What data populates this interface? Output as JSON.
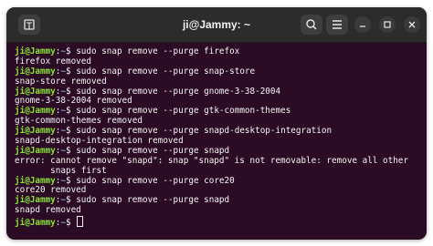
{
  "window": {
    "title": "ji@Jammy: ~"
  },
  "icons": {
    "new_tab": "new-tab-icon",
    "search": "search-icon",
    "menu": "hamburger-menu-icon",
    "minimize": "minimize-icon",
    "maximize": "maximize-icon",
    "close": "close-icon"
  },
  "colors": {
    "terminal_bg": "#2c0b24",
    "titlebar_bg": "#2c2c2c",
    "prompt_user": "#8ae234",
    "prompt_path": "#729fcf",
    "text": "#f4f4f4"
  },
  "prompt": {
    "user_host": "ji@Jammy",
    "path": "~",
    "symbol": "$"
  },
  "lines": [
    {
      "type": "command",
      "text": " sudo snap remove --purge firefox"
    },
    {
      "type": "output",
      "text": "firefox removed"
    },
    {
      "type": "command",
      "text": " sudo snap remove --purge snap-store"
    },
    {
      "type": "output",
      "text": "snap-store removed"
    },
    {
      "type": "command",
      "text": " sudo snap remove --purge gnome-3-38-2004"
    },
    {
      "type": "output",
      "text": "gnome-3-38-2004 removed"
    },
    {
      "type": "command",
      "text": " sudo snap remove --purge gtk-common-themes"
    },
    {
      "type": "output",
      "text": "gtk-common-themes removed"
    },
    {
      "type": "command",
      "text": " sudo snap remove --purge snapd-desktop-integration"
    },
    {
      "type": "output",
      "text": "snapd-desktop-integration removed"
    },
    {
      "type": "command",
      "text": " sudo snap remove --purge snapd"
    },
    {
      "type": "output",
      "text": "error: cannot remove \"snapd\": snap \"snapd\" is not removable: remove all other"
    },
    {
      "type": "output",
      "text": "       snaps first"
    },
    {
      "type": "command",
      "text": " sudo snap remove --purge core20"
    },
    {
      "type": "output",
      "text": "core20 removed"
    },
    {
      "type": "command",
      "text": " sudo snap remove --purge snapd"
    },
    {
      "type": "output",
      "text": "snapd removed"
    },
    {
      "type": "prompt",
      "text": " "
    }
  ]
}
